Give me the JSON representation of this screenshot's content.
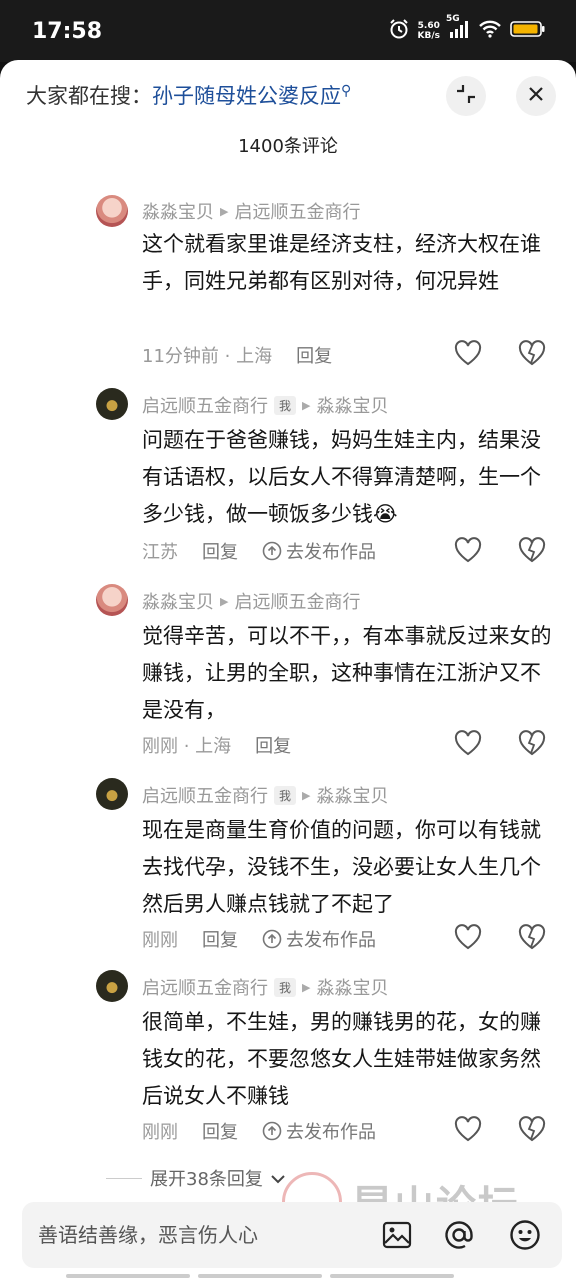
{
  "status": {
    "time": "17:58",
    "speed_value": "5.60",
    "speed_unit": "KB/s",
    "network": "5G"
  },
  "header": {
    "search_prefix": "大家都在搜：",
    "search_keyword": "孙子随母姓公婆反应",
    "comment_count": "1400条评论"
  },
  "comments": [
    {
      "author": "淼淼宝贝",
      "reply_to": "启远顺五金商行",
      "is_me": false,
      "text": "这个就看家里谁是经济支柱，经济大权在谁手，同姓兄弟都有区别对待，何况异姓",
      "time_location": "11分钟前 · 上海",
      "reply_label": "回复",
      "share_label": ""
    },
    {
      "author": "启远顺五金商行",
      "reply_to": "淼淼宝贝",
      "is_me": true,
      "text": "问题在于爸爸赚钱，妈妈生娃主内，结果没有话语权，以后女人不得算清楚啊，生一个多少钱，做一顿饭多少钱😭",
      "time_location": "江苏",
      "reply_label": "回复",
      "share_label": "去发布作品"
    },
    {
      "author": "淼淼宝贝",
      "reply_to": "启远顺五金商行",
      "is_me": false,
      "text": "觉得辛苦，可以不干，，有本事就反过来女的赚钱，让男的全职，这种事情在江浙沪又不是没有，",
      "time_location": "刚刚 · 上海",
      "reply_label": "回复",
      "share_label": ""
    },
    {
      "author": "启远顺五金商行",
      "reply_to": "淼淼宝贝",
      "is_me": true,
      "text": "现在是商量生育价值的问题，你可以有钱就去找代孕，没钱不生，没必要让女人生几个然后男人赚点钱就了不起了",
      "time_location": "刚刚",
      "reply_label": "回复",
      "share_label": "去发布作品"
    },
    {
      "author": "启远顺五金商行",
      "reply_to": "淼淼宝贝",
      "is_me": true,
      "text": "很简单，不生娃，男的赚钱男的花，女的赚钱女的花，不要忽悠女人生娃带娃做家务然后说女人不赚钱",
      "time_location": "刚刚",
      "reply_label": "回复",
      "share_label": "去发布作品"
    }
  ],
  "me_badge": "我",
  "expand_label": "展开38条回复",
  "input": {
    "placeholder": "善语结善缘，恶言伤人心"
  },
  "watermark": {
    "text": "昆山论坛"
  },
  "icons": {
    "alarm": "alarm-icon",
    "signal": "signal-icon",
    "wifi": "wifi-icon",
    "battery": "battery-icon",
    "collapse": "collapse-icon",
    "close": "close-icon",
    "heart": "heart-icon",
    "dislike": "dislike-icon",
    "share": "share-icon",
    "image": "image-icon",
    "at": "at-icon",
    "emoji": "emoji-icon"
  },
  "colors": {
    "keyword": "#1e4f9a",
    "battery": "#f5b400",
    "text": "#161616",
    "muted": "#999999"
  }
}
